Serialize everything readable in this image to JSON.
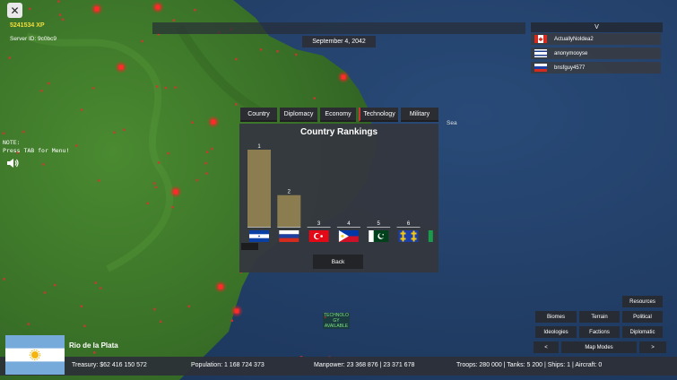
{
  "hud": {
    "xp": "5241534 XP",
    "server_id": "Server ID: 9c0bc9",
    "note_line1": "NOTE:",
    "note_line2": "Press TAB for Menu!",
    "close_glyph": "✕"
  },
  "date": "September 4, 2042",
  "players": {
    "header": "V",
    "list": [
      {
        "name": "ActuallyNoIdea2",
        "flag": "canada-like"
      },
      {
        "name": "anonymooyse",
        "flag": "finland-like"
      },
      {
        "name": "bnsfguy4577",
        "flag": "russia"
      }
    ]
  },
  "rankings": {
    "tabs": [
      "Country",
      "Diplomacy",
      "Economy",
      "Technology",
      "Military"
    ],
    "active_tab": "Technology",
    "title": "Country Rankings",
    "back_label": "Back"
  },
  "chart_data": {
    "type": "bar",
    "categories": [
      "1",
      "2",
      "3",
      "4",
      "5",
      "6"
    ],
    "values": [
      100,
      41,
      0,
      0,
      0,
      0
    ],
    "flags": [
      "honduras",
      "russia",
      "turkey",
      "philippines",
      "pakistan",
      "gold-crosses"
    ],
    "bar_color": "#8b7d4f"
  },
  "map": {
    "sea_label": "Sea",
    "tech_badge_line1": "TECHNOLO",
    "tech_badge_line2": "GY",
    "tech_badge_line3": "AVAILABLE"
  },
  "map_modes": {
    "resources": "Resources",
    "biomes": "Biomes",
    "terrain": "Terrain",
    "political": "Political",
    "ideologies": "Ideologies",
    "factions": "Factions",
    "diplomatic": "Diplomatic",
    "prev": "<",
    "label": "Map Modes",
    "next": ">"
  },
  "country": {
    "name": "Rio de la Plata",
    "treasury": "Treasury:   $62 416 150 572",
    "population": "Population: 1 168 724 373",
    "manpower": "Manpower:  23 368 876  |  23 371 678",
    "military": "Troops: 280 000  |  Tanks: 5 200  |  Ships: 1  |  Aircraft: 0"
  },
  "colors": {
    "ocean": "#22416a",
    "land": "#3d7a2a",
    "city_marker": "#ff2222",
    "xp": "#f2dc3c"
  }
}
